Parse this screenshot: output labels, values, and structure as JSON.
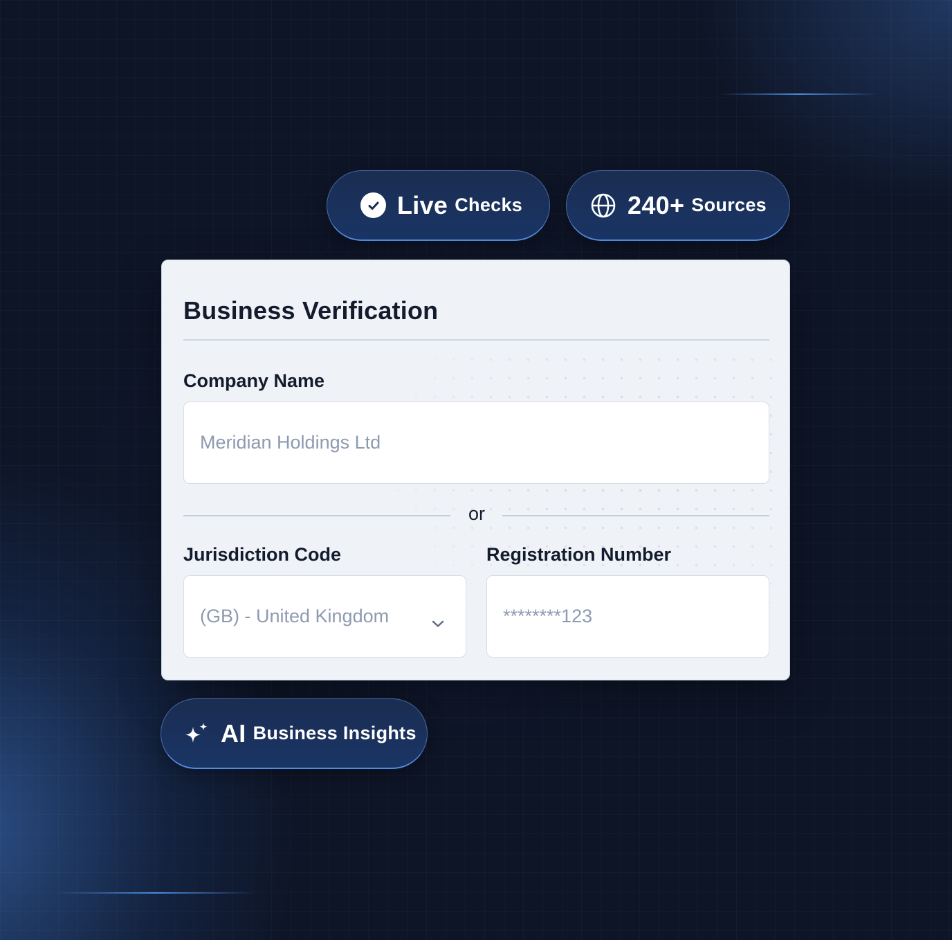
{
  "badges": {
    "live_checks": {
      "strong": "Live",
      "light": "Checks",
      "icon": "check-circle-icon"
    },
    "sources": {
      "strong": "240+",
      "light": "Sources",
      "icon": "globe-icon"
    },
    "ai_insights": {
      "strong": "AI",
      "light": "Business Insights",
      "icon": "sparkle-icon"
    }
  },
  "form": {
    "title": "Business Verification",
    "company_name": {
      "label": "Company Name",
      "placeholder": "Meridian Holdings Ltd"
    },
    "separator": "or",
    "jurisdiction": {
      "label": "Jurisdiction Code",
      "value": "(GB) - United Kingdom",
      "icon": "chevron-down-icon"
    },
    "registration": {
      "label": "Registration Number",
      "placeholder": "********123"
    }
  },
  "colors": {
    "background": "#0e1527",
    "pill": "#1a3565",
    "card": "#eff3f8",
    "text_dark": "#141b2d",
    "placeholder": "#8d9ab0",
    "accent_glow": "#5096f0"
  }
}
